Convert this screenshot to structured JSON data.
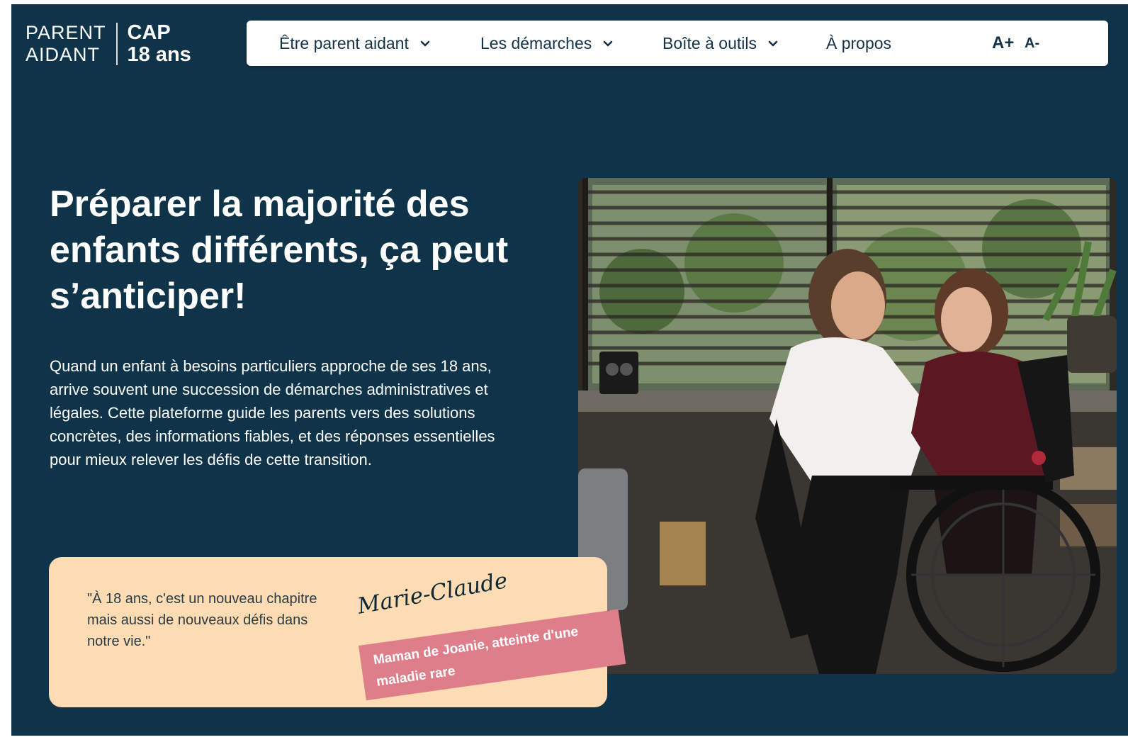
{
  "logo": {
    "line1": "PARENT",
    "line2": "AIDANT",
    "line3": "CAP",
    "line4": "18 ans"
  },
  "nav": {
    "items": [
      {
        "label": "Être parent aidant",
        "icon": "chevron-down-icon"
      },
      {
        "label": "Les démarches",
        "icon": "chevron-down-icon"
      },
      {
        "label": "Boîte à outils",
        "icon": "chevron-down-icon"
      },
      {
        "label": "À propos"
      }
    ],
    "font_increase": "A+",
    "font_decrease": "A-"
  },
  "hero": {
    "title": "Préparer la majorité des enfants différents, ça peut s’anticiper!",
    "text": "Quand un enfant à besoins particuliers approche de ses 18 ans, arrive souvent une succession de démarches administratives et légales. Cette plateforme guide les parents vers des solutions concrètes, des informations fiables, et des réponses essentielles pour mieux relever les défis de cette transition."
  },
  "testimonial": {
    "quote": "\"À 18 ans, c'est un nouveau chapitre mais aussi de nouveaux défis dans notre vie.\"",
    "name": "Marie-Claude",
    "caption": "Maman de Joanie, atteinte d'une maladie rare"
  },
  "colors": {
    "background": "#0f3449",
    "quote_card": "#fddcb4",
    "caption_tag": "#de7e8b",
    "nav_text": "#153347"
  }
}
